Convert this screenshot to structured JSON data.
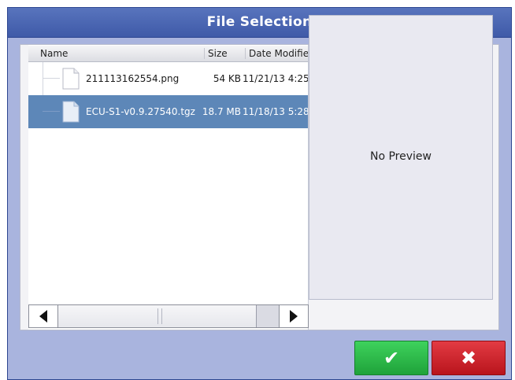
{
  "dialog": {
    "title": "File Selection"
  },
  "file_list": {
    "columns": [
      "Name",
      "Size",
      "Date Modifiec"
    ],
    "rows": [
      {
        "name": "211113162554.png",
        "size": "54 KB",
        "date": "11/21/13 4:25",
        "selected": false
      },
      {
        "name": "ECU-S1-v0.9.27540.tgz",
        "size": "18.7 MB",
        "date": "11/18/13 5:28",
        "selected": true
      }
    ],
    "scroll_left_icon": "triangle-left-icon",
    "scroll_right_icon": "triangle-right-icon"
  },
  "preview": {
    "text": "No Preview"
  },
  "buttons": {
    "ok_icon": "checkmark-icon",
    "ok_glyph": "✔",
    "cancel_icon": "x-icon",
    "cancel_glyph": "✖"
  },
  "colors": {
    "title_bar": "#4661ae",
    "dialog_bg": "#a9b4de",
    "selection": "#5d87b8",
    "ok_button": "#2bb84a",
    "cancel_button": "#d0232b"
  }
}
